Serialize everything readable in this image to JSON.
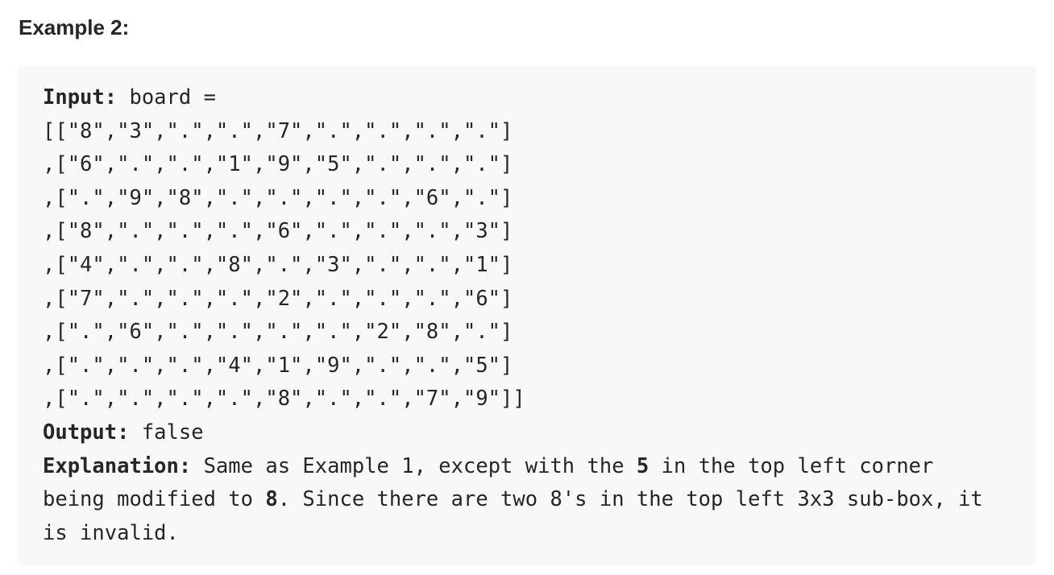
{
  "heading": "Example 2:",
  "input": {
    "label": "Input:",
    "lines": [
      " board = ",
      "[[\"8\",\"3\",\".\",\".\",\"7\",\".\",\".\",\".\",\".\"]",
      ",[\"6\",\".\",\".\",\"1\",\"9\",\"5\",\".\",\".\",\".\"]",
      ",[\".\",\"9\",\"8\",\".\",\".\",\".\",\".\",\"6\",\".\"]",
      ",[\"8\",\".\",\".\",\".\",\"6\",\".\",\".\",\".\",\"3\"]",
      ",[\"4\",\".\",\".\",\"8\",\".\",\"3\",\".\",\".\",\"1\"]",
      ",[\"7\",\".\",\".\",\".\",\"2\",\".\",\".\",\".\",\"6\"]",
      ",[\".\",\"6\",\".\",\".\",\".\",\".\",\"2\",\"8\",\".\"]",
      ",[\".\",\".\",\".\",\"4\",\"1\",\"9\",\".\",\".\",\"5\"]",
      ",[\".\",\".\",\".\",\".\",\"8\",\".\",\".\",\"7\",\"9\"]]"
    ]
  },
  "output": {
    "label": "Output:",
    "value": " false"
  },
  "explanation": {
    "label": "Explanation:",
    "part1": " Same as Example 1, except with the ",
    "bold1": "5",
    "part2": " in the top left corner",
    "part3": "being modified to ",
    "bold2": "8",
    "part4": ". Since there are two 8's in the top left 3x3 sub-box, it",
    "part5": "is invalid."
  }
}
